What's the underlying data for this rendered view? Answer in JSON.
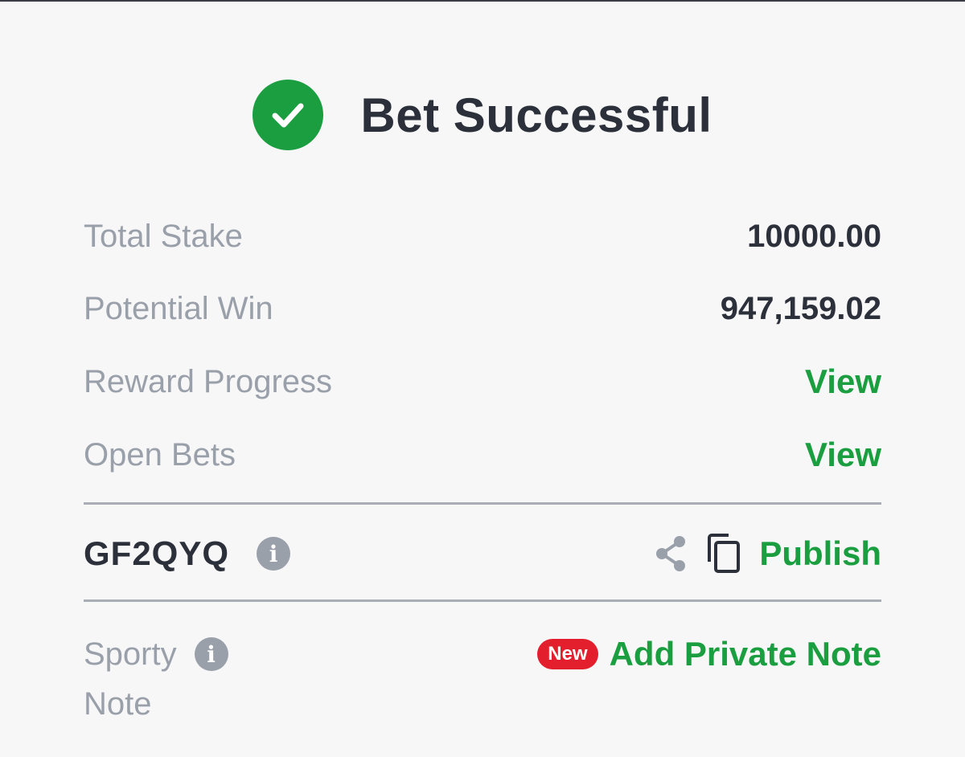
{
  "header": {
    "title": "Bet Successful",
    "icon": "check-circle-icon",
    "accent_color": "#1a9e3f"
  },
  "summary": {
    "total_stake_label": "Total Stake",
    "total_stake_value": "10000.00",
    "potential_win_label": "Potential Win",
    "potential_win_value": "947,159.02",
    "reward_progress_label": "Reward Progress",
    "reward_progress_link": "View",
    "open_bets_label": "Open Bets",
    "open_bets_link": "View"
  },
  "booking": {
    "code": "GF2QYQ",
    "info_icon": "info-icon",
    "share_icon": "share-icon",
    "copy_icon": "copy-icon",
    "publish_label": "Publish"
  },
  "note": {
    "label_line1": "Sporty",
    "label_line2": "Note",
    "badge": "New",
    "badge_color": "#e41f2d",
    "add_note_label": "Add Private Note"
  }
}
